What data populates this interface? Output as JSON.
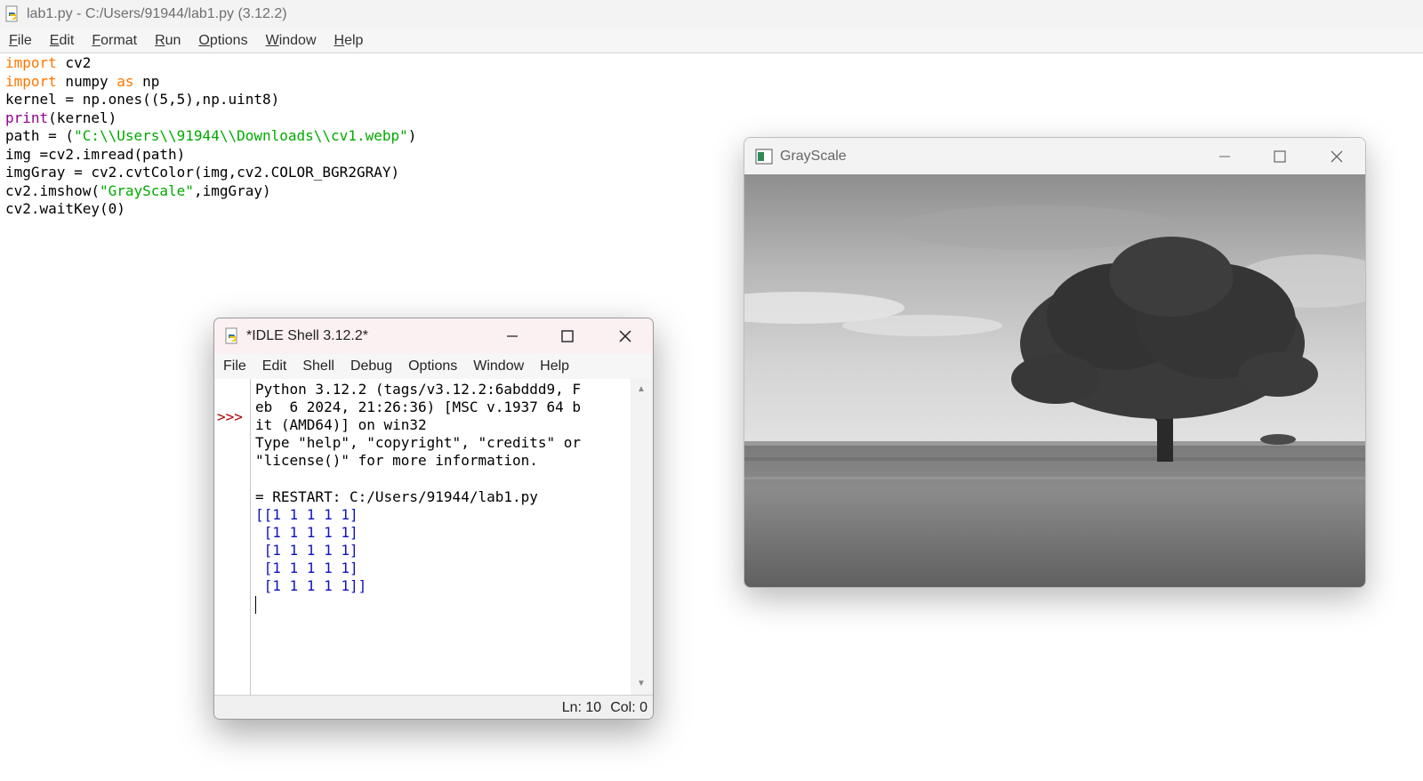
{
  "editor": {
    "title": "lab1.py - C:/Users/91944/lab1.py (3.12.2)",
    "menu": [
      {
        "underline": "F",
        "rest": "ile"
      },
      {
        "underline": "E",
        "rest": "dit"
      },
      {
        "underline": "F",
        "rest": "ormat"
      },
      {
        "underline": "R",
        "rest": "un"
      },
      {
        "underline": "O",
        "rest": "ptions"
      },
      {
        "underline": "W",
        "rest": "indow"
      },
      {
        "underline": "H",
        "rest": "elp"
      }
    ],
    "code": {
      "l1_kw": "import",
      "l1_rest": " cv2",
      "l2_kw": "import",
      "l2_mid": " numpy ",
      "l2_kw2": "as",
      "l2_rest": " np",
      "l3": "kernel = np.ones((5,5),np.uint8)",
      "l4_bi": "print",
      "l4_rest": "(kernel)",
      "l5_a": "path = (",
      "l5_str": "\"C:\\\\Users\\\\91944\\\\Downloads\\\\cv1.webp\"",
      "l5_b": ")",
      "l6": "img =cv2.imread(path)",
      "l7": "imgGray = cv2.cvtColor(img,cv2.COLOR_BGR2GRAY)",
      "l8_a": "cv2.imshow(",
      "l8_str": "\"GrayScale\"",
      "l8_b": ",imgGray)",
      "l9": "cv2.waitKey(0)"
    }
  },
  "grayscale_window": {
    "title": "GrayScale"
  },
  "shell": {
    "title": "*IDLE Shell 3.12.2*",
    "menu": [
      "File",
      "Edit",
      "Shell",
      "Debug",
      "Options",
      "Window",
      "Help"
    ],
    "prompt": ">>>",
    "lines": [
      "Python 3.12.2 (tags/v3.12.2:6abddd9, F",
      "eb  6 2024, 21:26:36) [MSC v.1937 64 b",
      "it (AMD64)] on win32",
      "Type \"help\", \"copyright\", \"credits\" or",
      "\"license()\" for more information.",
      "",
      "= RESTART: C:/Users/91944/lab1.py"
    ],
    "output": [
      "[[1 1 1 1 1]",
      " [1 1 1 1 1]",
      " [1 1 1 1 1]",
      " [1 1 1 1 1]",
      " [1 1 1 1 1]]"
    ],
    "status": {
      "line": "Ln: 10",
      "col": "Col: 0"
    }
  }
}
